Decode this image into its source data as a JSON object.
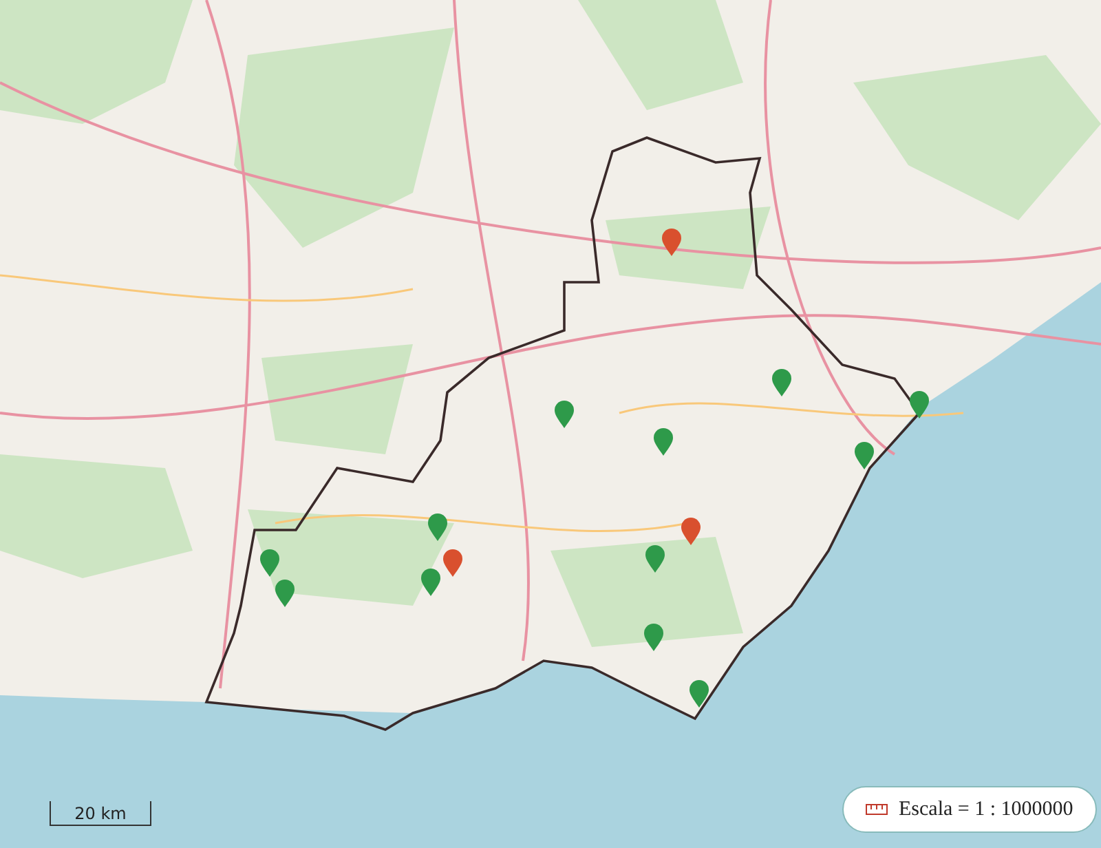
{
  "map": {
    "markers": [
      {
        "color": "#d9502e"
      },
      {
        "color": "#2e9a4a"
      },
      {
        "color": "#2e9a4a"
      },
      {
        "color": "#2e9a4a"
      },
      {
        "color": "#2e9a4a"
      },
      {
        "color": "#2e9a4a"
      },
      {
        "color": "#d9502e"
      },
      {
        "color": "#2e9a4a"
      },
      {
        "color": "#d9502e"
      },
      {
        "color": "#2e9a4a"
      },
      {
        "color": "#2e9a4a"
      },
      {
        "color": "#2e9a4a"
      },
      {
        "color": "#2e9a4a"
      },
      {
        "color": "#2e9a4a"
      },
      {
        "color": "#2e9a4a"
      }
    ]
  },
  "scale_bar": {
    "label": "20 km"
  },
  "scale_control": {
    "label": "Escala = 1 : 1000000"
  }
}
